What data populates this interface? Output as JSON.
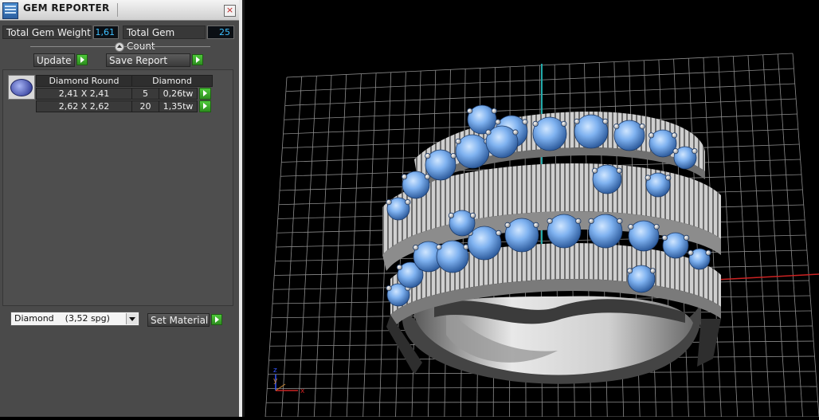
{
  "window": {
    "title": "GEM REPORTER",
    "close_label": "×"
  },
  "totals": {
    "weight_label": "Total Gem Weight",
    "weight_value": "1,61",
    "count_label": "Total Gem Count",
    "count_value": "25"
  },
  "toolbar": {
    "update_label": "Update",
    "save_report_label": "Save Report"
  },
  "gem_table": {
    "headers": [
      "Diamond Round",
      "Diamond"
    ],
    "rows": [
      {
        "size": "2,41 X 2,41",
        "count": "5",
        "weight": "0,26tw"
      },
      {
        "size": "2,62 X 2,62",
        "count": "20",
        "weight": "1,35tw"
      }
    ]
  },
  "material": {
    "selected_name": "Diamond",
    "selected_density": "(3,52 spg)",
    "set_label": "Set Material"
  },
  "viewport": {
    "axis_labels": {
      "x": "x",
      "y": "y",
      "z": "z"
    },
    "colors": {
      "background": "#000000",
      "grid": "#8c8c8c",
      "gem": "#7fb2f0",
      "metal": "#d6d6d6",
      "axis_x": "#cc2222",
      "axis_y": "#22aaaa",
      "axis_z": "#3355ff"
    }
  }
}
